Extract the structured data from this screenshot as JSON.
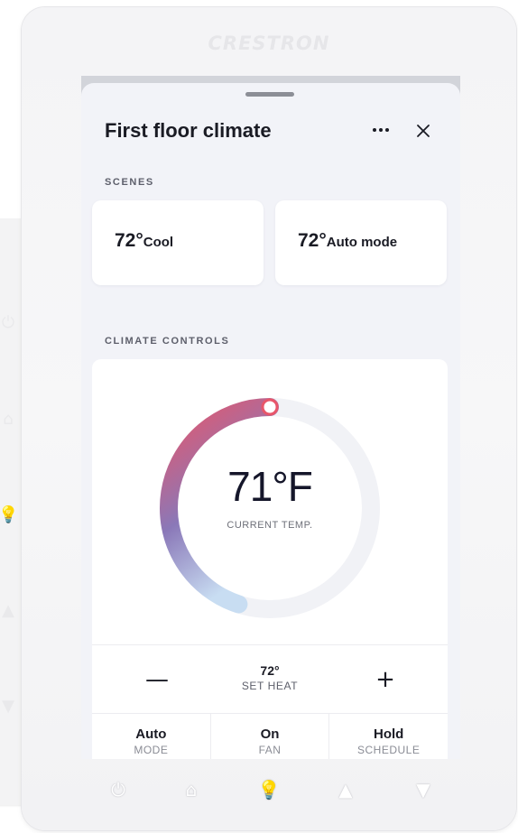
{
  "device": {
    "brand": "CRESTRON",
    "hardware_buttons": [
      {
        "icon": "power-icon",
        "glyph": "⏻"
      },
      {
        "icon": "home-icon",
        "glyph": "⌂"
      },
      {
        "icon": "lightbulb-icon",
        "glyph": "💡"
      },
      {
        "icon": "arrow-up-icon",
        "glyph": "▲"
      },
      {
        "icon": "arrow-down-icon",
        "glyph": "▼"
      }
    ]
  },
  "panel": {
    "title": "First floor climate",
    "more_icon": "more-horizontal-icon",
    "close_icon": "close-icon"
  },
  "scenes": {
    "label": "SCENES",
    "items": [
      {
        "temp": "72°",
        "mode": "Cool"
      },
      {
        "temp": "72°",
        "mode": "Auto mode"
      }
    ]
  },
  "climate": {
    "label": "CLIMATE CONTROLS",
    "current_temp": "71°F",
    "current_label": "CURRENT TEMP.",
    "setpoint": {
      "decrement_icon": "minus-icon",
      "decrement_glyph": "—",
      "value": "72°",
      "label": "SET HEAT",
      "increment_icon": "plus-icon",
      "increment_glyph": "+"
    },
    "modes": [
      {
        "value": "Auto",
        "label": "MODE"
      },
      {
        "value": "On",
        "label": "FAN"
      },
      {
        "value": "Hold",
        "label": "SCHEDULE"
      }
    ],
    "dial_fill": 0.45,
    "colors": {
      "warm": "#e8566a",
      "mid": "#8a78b8",
      "cool": "#c8ddf2",
      "track": "#f1f2f6"
    }
  }
}
